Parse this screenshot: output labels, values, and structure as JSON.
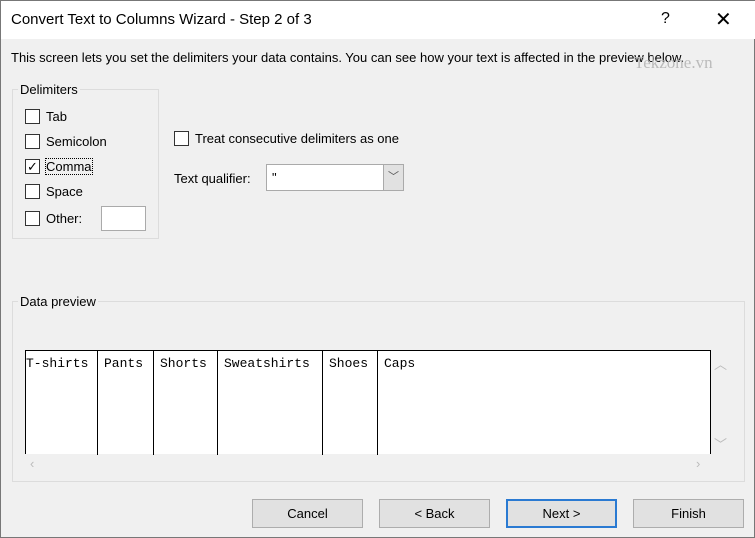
{
  "window": {
    "title": "Convert Text to Columns Wizard - Step 2 of 3",
    "help": "?",
    "close": "✕"
  },
  "intro": "This screen lets you set the delimiters your data contains.  You can see how your text is affected in the preview below.",
  "watermark": "Tekzone.vn",
  "delimiters": {
    "label": "Delimiters",
    "items": [
      {
        "label": "Tab",
        "checked": false
      },
      {
        "label": "Semicolon",
        "checked": false
      },
      {
        "label": "Comma",
        "checked": true
      },
      {
        "label": "Space",
        "checked": false
      },
      {
        "label": "Other:",
        "checked": false
      }
    ],
    "other_value": ""
  },
  "consecutive": {
    "label": "Treat consecutive delimiters as one",
    "checked": false
  },
  "qualifier": {
    "label": "Text qualifier:",
    "value": "\""
  },
  "preview": {
    "label": "Data preview",
    "columns": [
      "T-shirts",
      "Pants",
      "Shorts",
      "Sweatshirts",
      "Shoes",
      "Caps"
    ]
  },
  "buttons": {
    "cancel": "Cancel",
    "back": "< Back",
    "next": "Next >",
    "finish": "Finish"
  }
}
